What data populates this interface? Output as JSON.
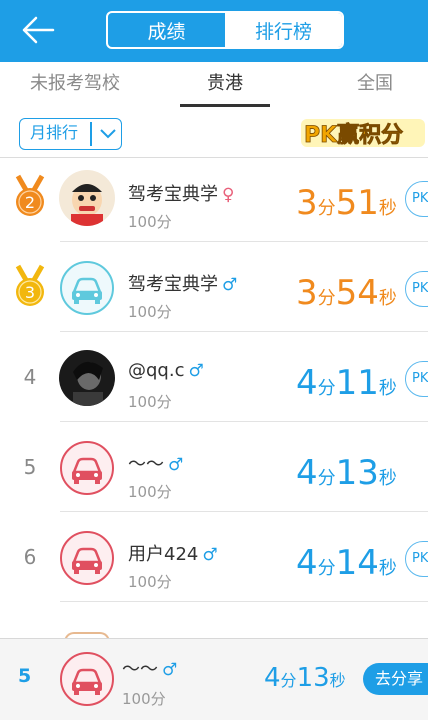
{
  "header": {
    "segments": [
      "成绩",
      "排行榜"
    ],
    "active_segment": "排行榜"
  },
  "tabs": [
    {
      "label": "未报考驾校"
    },
    {
      "label": "贵港"
    },
    {
      "label": "全国"
    }
  ],
  "filter": {
    "month_label": "月排行",
    "pk_logo_text": "PK赢积分"
  },
  "rows": [
    {
      "rank": "2",
      "medal": "silver-orange",
      "name": "驾考宝典学",
      "gender": "♀",
      "score": "100分",
      "min": "3",
      "min_unit": "分",
      "sec": "51",
      "sec_unit": "秒",
      "time_color": "orange",
      "pk": "PK",
      "avatar": "cartoon"
    },
    {
      "rank": "3",
      "medal": "gold",
      "name": "驾考宝典学",
      "gender": "♂",
      "score": "100分",
      "min": "3",
      "min_unit": "分",
      "sec": "54",
      "sec_unit": "秒",
      "time_color": "orange",
      "pk": "PK",
      "avatar": "car-blue"
    },
    {
      "rank": "4",
      "name": "@qq.c",
      "gender": "♂",
      "score": "100分",
      "min": "4",
      "min_unit": "分",
      "sec": "11",
      "sec_unit": "秒",
      "time_color": "blue",
      "pk": "PK",
      "avatar": "photo"
    },
    {
      "rank": "5",
      "name": "〜〜",
      "gender": "♂",
      "score": "100分",
      "min": "4",
      "min_unit": "分",
      "sec": "13",
      "sec_unit": "秒",
      "time_color": "blue",
      "pk": "",
      "avatar": "car-red"
    },
    {
      "rank": "6",
      "name": "用户424",
      "gender": "♂",
      "score": "100分",
      "min": "4",
      "min_unit": "分",
      "sec": "14",
      "sec_unit": "秒",
      "time_color": "blue",
      "pk": "PK",
      "avatar": "car-red"
    }
  ],
  "my_rank": {
    "rank": "5",
    "name": "〜〜",
    "gender": "♂",
    "score": "100分",
    "min": "4",
    "min_unit": "分",
    "sec": "13",
    "sec_unit": "秒",
    "share_label": "去分享"
  },
  "colors": {
    "primary": "#1e9ee6",
    "orange": "#f08a1e",
    "female": "#e8607a"
  }
}
